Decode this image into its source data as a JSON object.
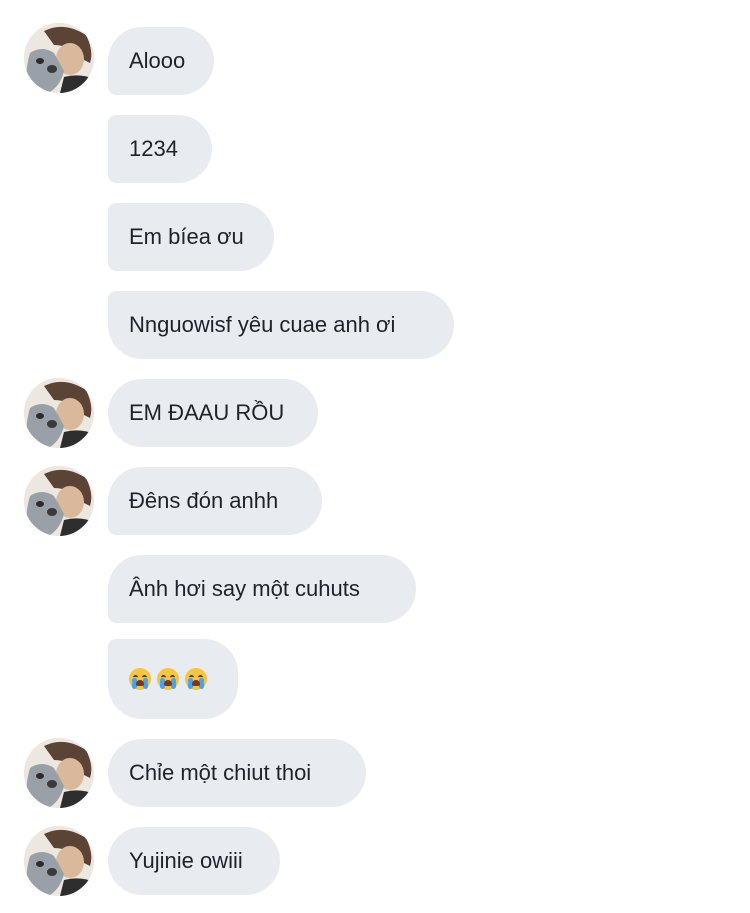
{
  "messages": [
    {
      "text": "Alooo",
      "avatar": true
    },
    {
      "text": "1234",
      "avatar": false
    },
    {
      "text": "Em bíea ơu",
      "avatar": false
    },
    {
      "text": "Nnguowisf yêu cuae anh ơi",
      "avatar": false
    },
    {
      "text": "EM ĐAAU RỒU",
      "avatar": true
    },
    {
      "text": "Đêns đón anhh",
      "avatar": true
    },
    {
      "text": "Ânh hơi say một cuhuts",
      "avatar": false
    },
    {
      "text": "",
      "emoji": [
        "loudly-crying-face",
        "loudly-crying-face",
        "loudly-crying-face"
      ],
      "avatar": false
    },
    {
      "text": "Chỉe một chiut thoi",
      "avatar": true
    },
    {
      "text": "Yujinie owiii",
      "avatar": true
    }
  ],
  "colors": {
    "bubble": "#e8ebf0",
    "text": "#1f2329",
    "background": "#ffffff"
  }
}
